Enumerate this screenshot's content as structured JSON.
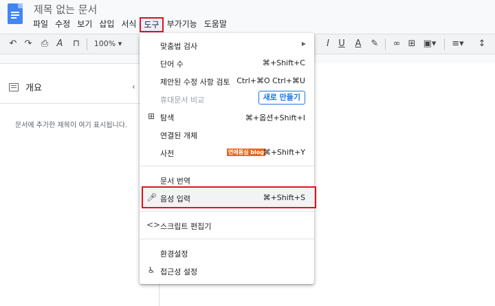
{
  "title": "제목 없는 문서",
  "menubar": [
    "파일",
    "수정",
    "보기",
    "삽입",
    "서식",
    "도구",
    "부가기능",
    "도움말"
  ],
  "toolbar": {
    "zoom": "100%"
  },
  "outline": {
    "title": "개요",
    "hint": "문서에 추가한 제목이 여기 표시됩니다."
  },
  "tools_menu": {
    "spellcheck": "맞춤법 검사",
    "word_count": "단어 수",
    "word_count_sc": "⌘+Shift+C",
    "review_edits": "제안된 수정 사항 검토",
    "review_edits_sc": "Ctrl+⌘O Ctrl+⌘U",
    "compare": "휴대문서 비교",
    "new_button": "새로 만들기",
    "explore": "탐색",
    "explore_sc": "⌘+옵션+Shift+I",
    "linked_objects": "연결된 개체",
    "dictionary": "사전",
    "dictionary_sc": "⌘+Shift+Y",
    "blog_tag": "연애몽심 blog",
    "translate": "문서 번역",
    "voice_typing": "음성 입력",
    "voice_typing_sc": "⌘+Shift+S",
    "script_editor": "스크립트 편집기",
    "preferences": "환경설정",
    "accessibility": "접근성 설정"
  },
  "colors": {
    "highlight_border": "#e0101d",
    "accent": "#1a73e8",
    "doc_icon": "#4285f4"
  }
}
